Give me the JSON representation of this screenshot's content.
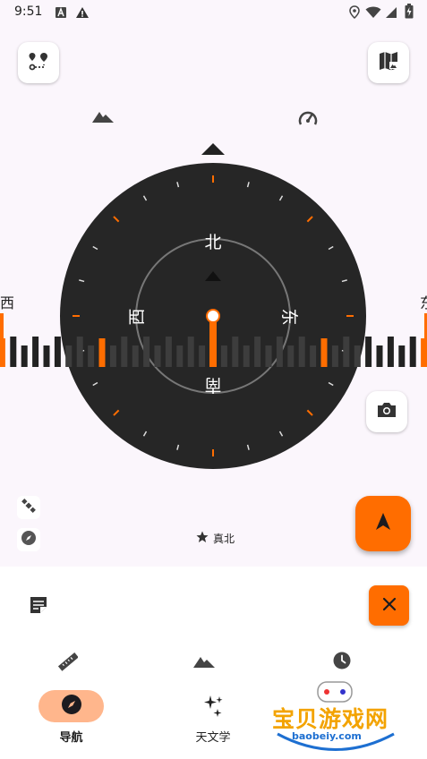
{
  "status_bar": {
    "time": "9:51",
    "icons_left": [
      "font-icon",
      "warning-icon"
    ],
    "icons_right": [
      "location-icon",
      "wifi-icon",
      "signal-icon",
      "battery-charging-icon"
    ]
  },
  "toolbar": {
    "left_button_icon": "route-icon",
    "right_button_icon": "map-icon",
    "indicator_left_icon": "mountain-icon",
    "indicator_right_icon": "speedometer-icon"
  },
  "compass": {
    "north": "北",
    "south": "南",
    "east": "东",
    "west": "西",
    "heading_deg": 0,
    "strip_left_label": "西",
    "strip_right_label": "东"
  },
  "side_buttons": {
    "camera_icon": "camera-icon",
    "satellite_icon": "satellite-icon",
    "compass_small_icon": "compass-icon",
    "navigate_icon": "navigation-arrow-icon"
  },
  "north_reference": {
    "label": "真北",
    "icon": "star-icon"
  },
  "bottom_sheet": {
    "note_icon": "note-icon",
    "close_icon": "close-icon",
    "tools": [
      "ruler-icon",
      "mountain-icon",
      "clock-icon"
    ],
    "tabs": [
      {
        "label": "导航",
        "icon": "compass-icon",
        "active": true
      },
      {
        "label": "天文学",
        "icon": "sparkles-icon",
        "active": false
      }
    ]
  },
  "watermark": {
    "text": "宝贝游戏网",
    "url": "baobeiy.com"
  },
  "colors": {
    "accent": "#ff6d00",
    "dial": "#262626",
    "background": "#fbf6fc",
    "pill": "#ffb68c"
  }
}
